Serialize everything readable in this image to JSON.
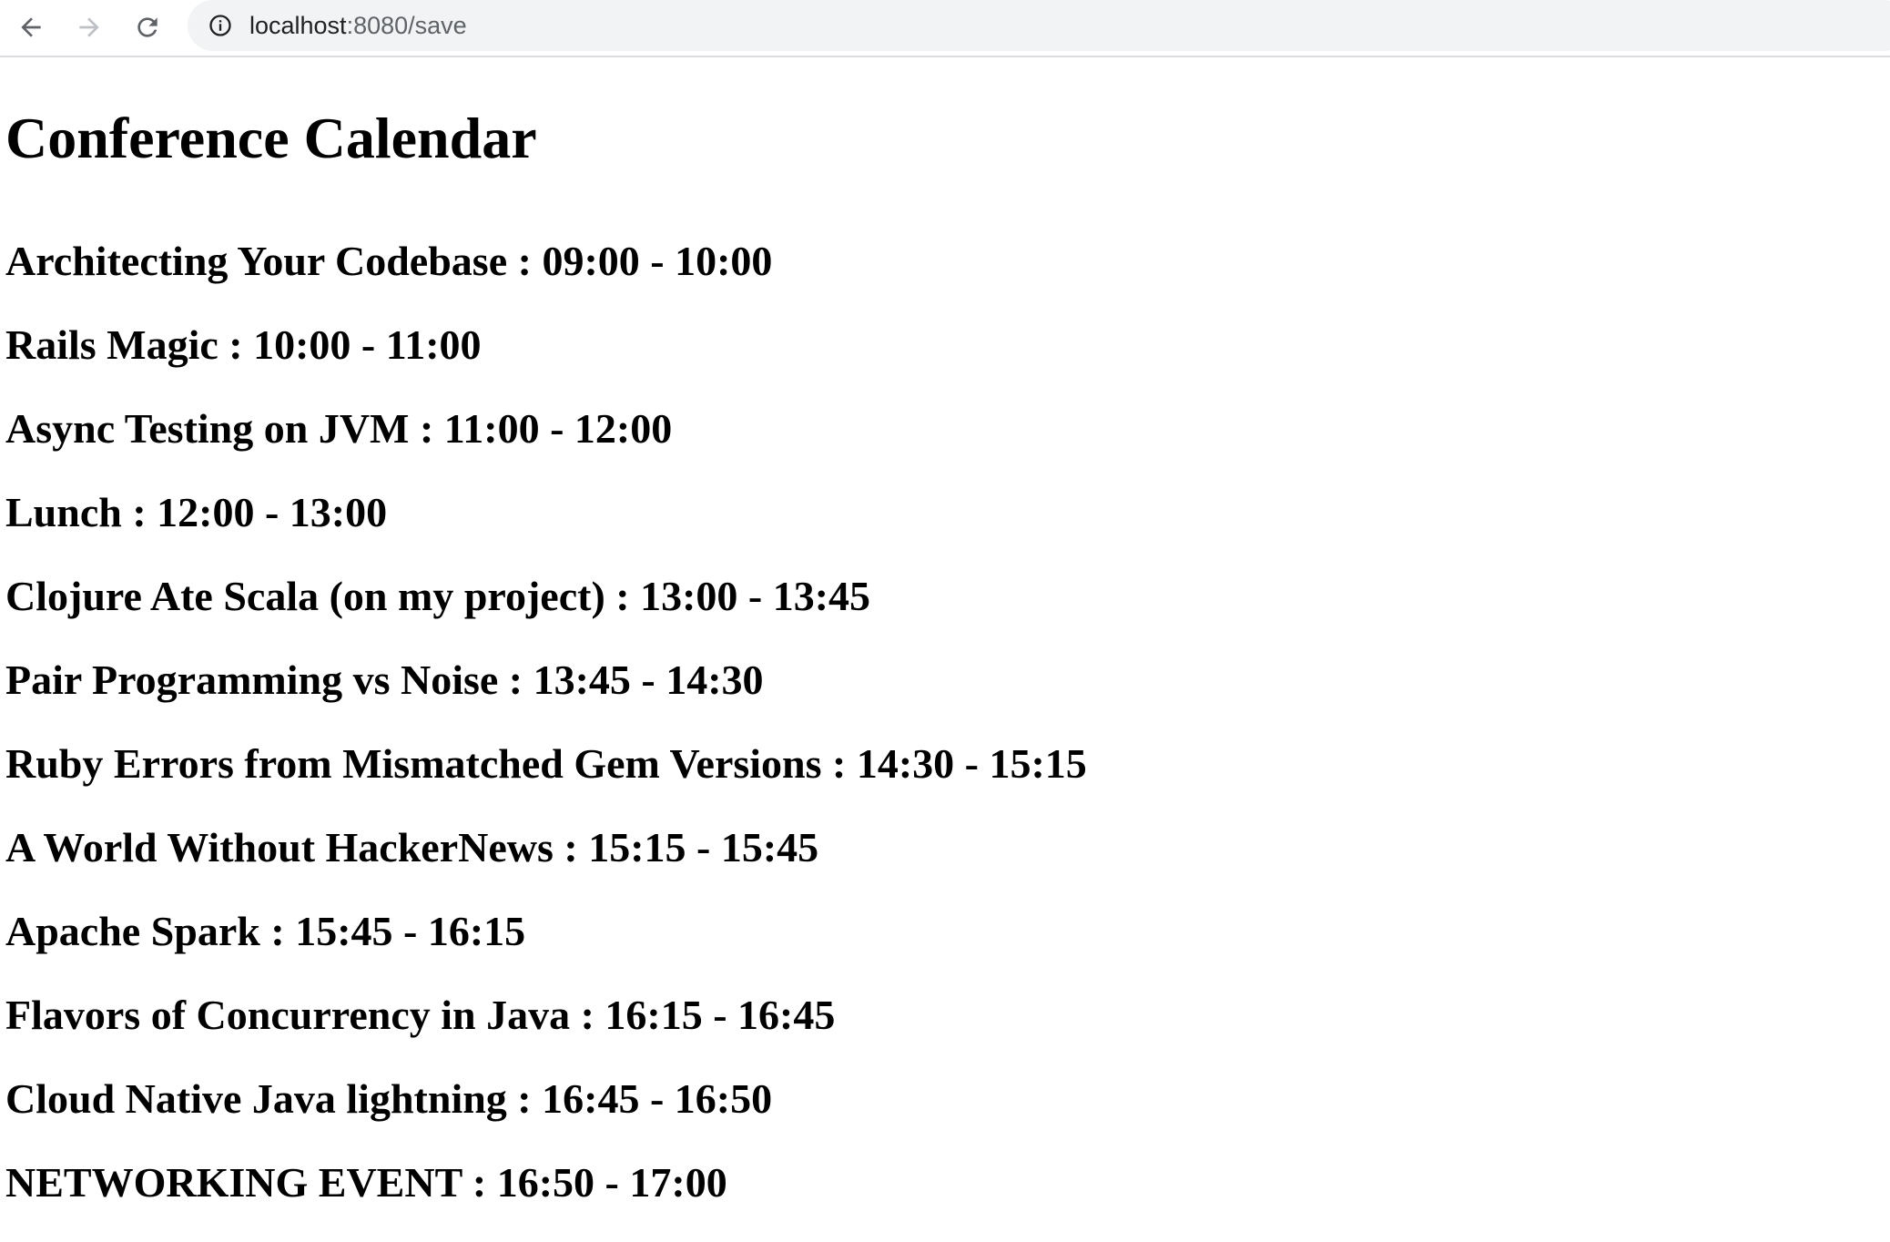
{
  "browser": {
    "url_host": "localhost",
    "url_rest": ":8080/save"
  },
  "page": {
    "title": "Conference Calendar",
    "sessions": [
      {
        "text": "Architecting Your Codebase : 09:00 - 10:00"
      },
      {
        "text": "Rails Magic : 10:00 - 11:00"
      },
      {
        "text": "Async Testing on JVM : 11:00 - 12:00"
      },
      {
        "text": "Lunch : 12:00 - 13:00"
      },
      {
        "text": "Clojure Ate Scala (on my project) : 13:00 - 13:45"
      },
      {
        "text": "Pair Programming vs Noise : 13:45 - 14:30"
      },
      {
        "text": "Ruby Errors from Mismatched Gem Versions : 14:30 - 15:15"
      },
      {
        "text": "A World Without HackerNews : 15:15 - 15:45"
      },
      {
        "text": "Apache Spark : 15:45 - 16:15"
      },
      {
        "text": "Flavors of Concurrency in Java : 16:15 - 16:45"
      },
      {
        "text": "Cloud Native Java lightning : 16:45 - 16:50"
      },
      {
        "text": "NETWORKING EVENT : 16:50 - 17:00"
      }
    ]
  },
  "icons": {
    "back": "arrow-left-icon",
    "forward": "arrow-right-icon",
    "reload": "reload-icon",
    "site_info": "info-icon"
  },
  "colors": {
    "omnibox_background": "#f1f3f4",
    "nav_icon_active": "#5f6368",
    "nav_icon_disabled": "#bdc1c6",
    "url_host": "#202124",
    "url_path": "#5f6368"
  }
}
